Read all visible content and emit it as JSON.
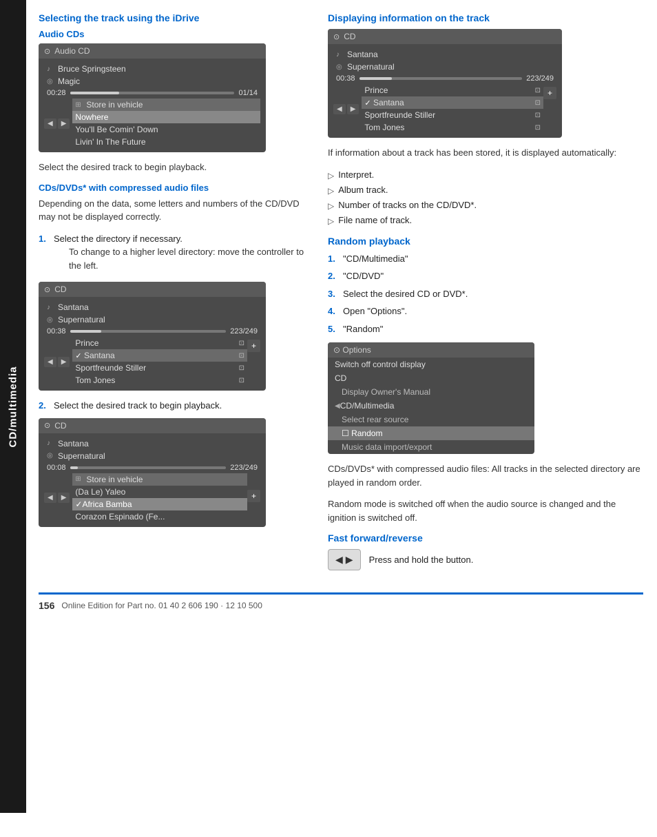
{
  "sidebar": {
    "label": "CD/multimedia"
  },
  "left_section": {
    "title": "Selecting the track using the iDrive",
    "sub_title1": "Audio CDs",
    "cd_ui1": {
      "header": "Audio CD",
      "artist": "Bruce Springsteen",
      "album": "Magic",
      "time": "00:28",
      "total": "01/14",
      "store": "Store in vehicle",
      "tracks": [
        "Nowhere",
        "You'll Be Comin' Down",
        "Livin' In The Future"
      ]
    },
    "para1": "Select the desired track to begin playback.",
    "sub_title2": "CDs/DVDs* with compressed audio files",
    "para2": "Depending on the data, some letters and numbers of the CD/DVD may not be displayed correctly.",
    "steps1": [
      {
        "num": "1.",
        "text": "Select the directory if necessary.",
        "indent": "To change to a higher level directory: move the controller to the left."
      }
    ],
    "cd_ui2": {
      "header": "CD",
      "artist": "Santana",
      "album": "Supernatural",
      "time": "00:38",
      "total": "223/249",
      "tracks": [
        {
          "name": "Prince",
          "checked": false
        },
        {
          "name": "Santana",
          "checked": true
        },
        {
          "name": "Sportfreunde Stiller",
          "checked": false
        },
        {
          "name": "Tom Jones",
          "checked": false
        }
      ]
    },
    "steps2_num": "2.",
    "steps2_text": "Select the desired track to begin playback.",
    "cd_ui3": {
      "header": "CD",
      "artist": "Santana",
      "album": "Supernatural",
      "time": "00:08",
      "total": "223/249",
      "store": "Store in vehicle",
      "tracks": [
        {
          "name": "(Da Le) Yaleo",
          "checked": false
        },
        {
          "name": "Africa Bamba",
          "checked": true
        },
        {
          "name": "Corazon Espinado (Fe...",
          "checked": false
        }
      ]
    }
  },
  "right_section": {
    "title": "Displaying information on the track",
    "cd_ui4": {
      "header": "CD",
      "artist": "Santana",
      "album": "Supernatural",
      "time": "00:38",
      "total": "223/249",
      "tracks": [
        {
          "name": "Prince",
          "checked": false
        },
        {
          "name": "Santana",
          "checked": true
        },
        {
          "name": "Sportfreunde Stiller",
          "checked": false
        },
        {
          "name": "Tom Jones",
          "checked": false
        }
      ]
    },
    "info_text": "If information about a track has been stored, it is displayed automatically:",
    "bullet_items": [
      "Interpret.",
      "Album track.",
      "Number of tracks on the CD/DVD*.",
      "File name of track."
    ],
    "random_title": "Random playback",
    "random_steps": [
      {
        "num": "1.",
        "text": "\"CD/Multimedia\""
      },
      {
        "num": "2.",
        "text": "\"CD/DVD\""
      },
      {
        "num": "3.",
        "text": "Select the desired CD or DVD*."
      },
      {
        "num": "4.",
        "text": "Open \"Options\"."
      },
      {
        "num": "5.",
        "text": "\"Random\""
      }
    ],
    "options_ui": {
      "header": "Options",
      "rows": [
        {
          "text": "Switch off control display",
          "highlighted": false,
          "sub": false
        },
        {
          "text": "CD",
          "highlighted": false,
          "sub": false
        },
        {
          "text": "Display Owner's Manual",
          "highlighted": false,
          "sub": true
        },
        {
          "text": "CD/Multimedia",
          "highlighted": false,
          "sub": false
        },
        {
          "text": "Select rear source",
          "highlighted": false,
          "sub": true
        },
        {
          "text": "Random",
          "highlighted": true,
          "sub": true
        },
        {
          "text": "Music data import/export",
          "highlighted": false,
          "sub": true
        }
      ]
    },
    "random_text1": "CDs/DVDs* with compressed audio files: All tracks in the selected directory are played in random order.",
    "random_text2": "Random mode is switched off when the audio source is changed and the ignition is switched off.",
    "ff_title": "Fast forward/reverse",
    "ff_text": "Press and hold the button."
  },
  "footer": {
    "page_num": "156",
    "text": "Online Edition for Part no. 01 40 2 606 190 · 12 10 500"
  }
}
